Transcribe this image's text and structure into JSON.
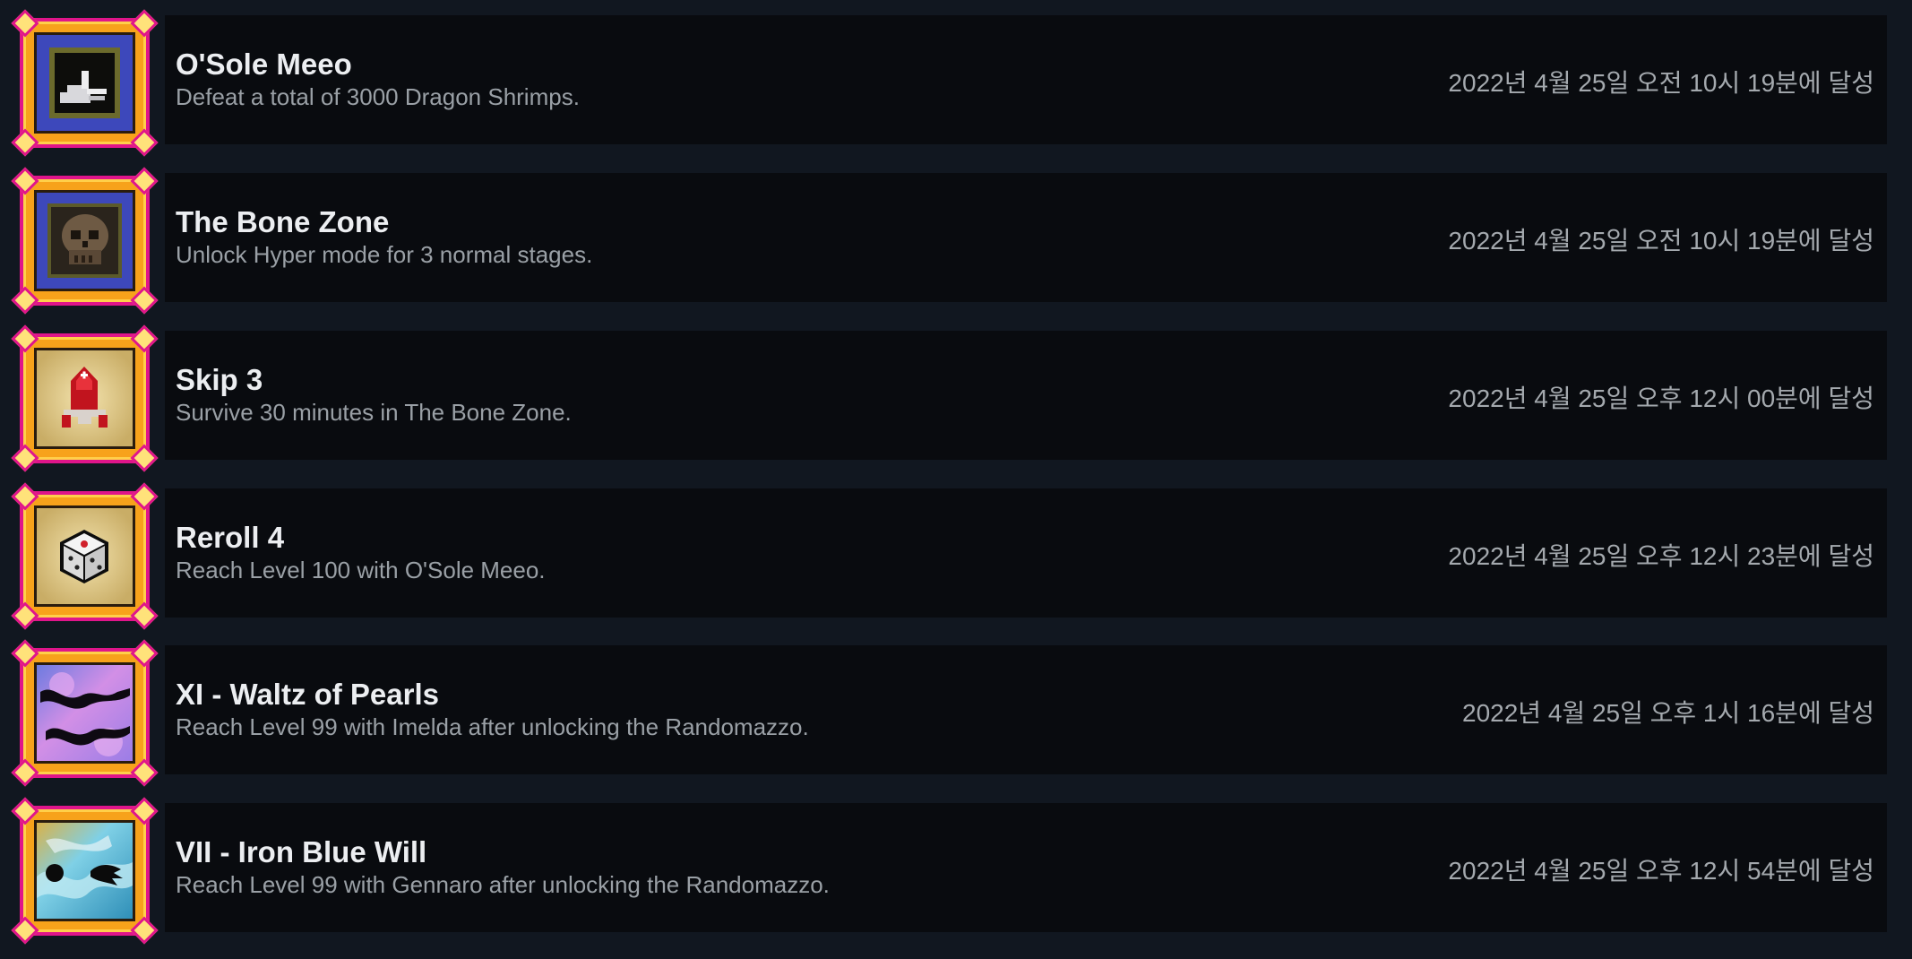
{
  "achievements": [
    {
      "title": "O'Sole Meeo",
      "description": "Defeat a total of 3000 Dragon Shrimps.",
      "unlocked": "2022년 4월 25일 오전 10시 19분에 달성",
      "icon": "pointing-hand-icon"
    },
    {
      "title": "The Bone Zone",
      "description": "Unlock Hyper mode for 3 normal stages.",
      "unlocked": "2022년 4월 25일 오전 10시 19분에 달성",
      "icon": "skull-icon"
    },
    {
      "title": "Skip 3",
      "description": "Survive 30 minutes in The Bone Zone.",
      "unlocked": "2022년 4월 25일 오후 12시 00분에 달성",
      "icon": "red-rocket-icon"
    },
    {
      "title": "Reroll 4",
      "description": "Reach Level 100 with O'Sole Meeo.",
      "unlocked": "2022년 4월 25일 오후 12시 23분에 달성",
      "icon": "dice-icon"
    },
    {
      "title": "XI - Waltz of Pearls",
      "description": "Reach Level 99 with Imelda after unlocking the Randomazzo.",
      "unlocked": "2022년 4월 25일 오후 1시 16분에 달성",
      "icon": "pink-waves-card-icon"
    },
    {
      "title": "VII - Iron Blue Will",
      "description": "Reach Level 99 with Gennaro after unlocking the Randomazzo.",
      "unlocked": "2022년 4월 25일 오후 12시 54분에 달성",
      "icon": "blue-storm-card-icon"
    }
  ]
}
